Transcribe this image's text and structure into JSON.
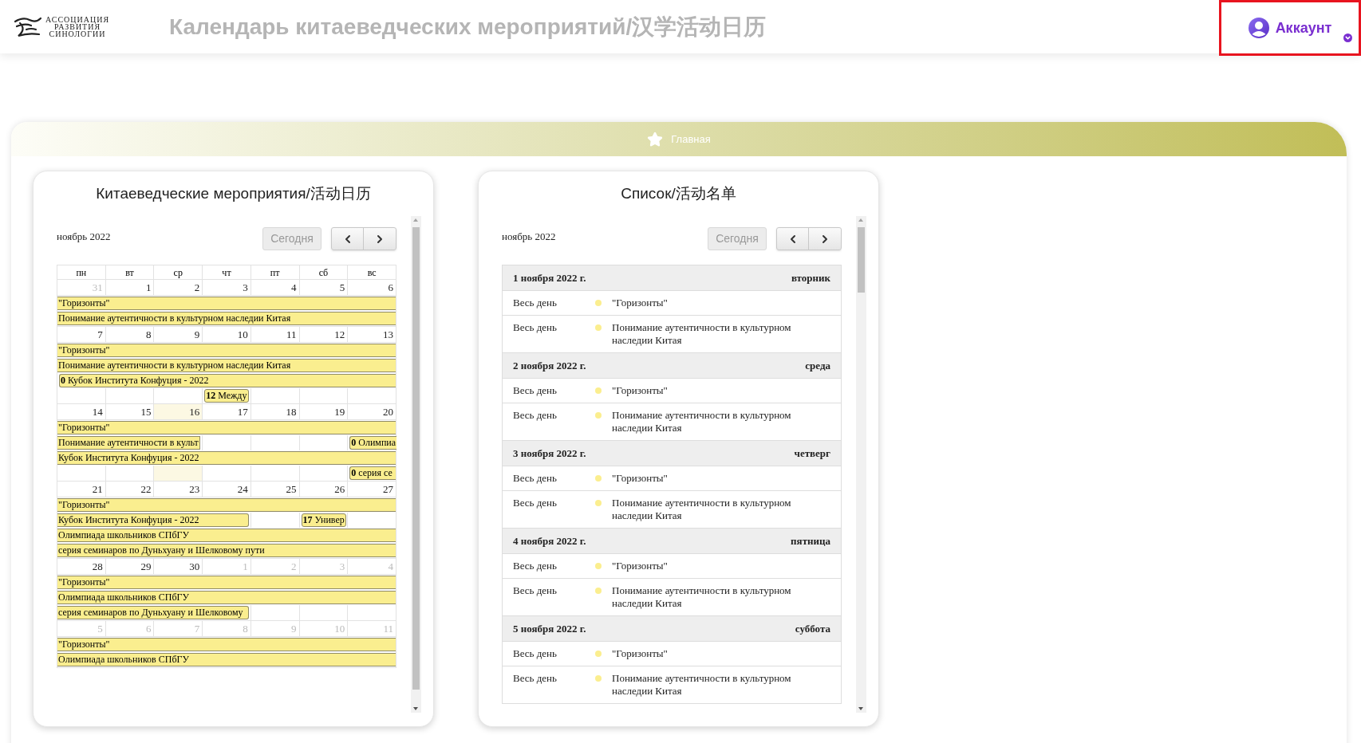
{
  "header": {
    "logo_lines": [
      "АССОЦИАЦИЯ",
      "РАЗВИТИЯ",
      "СИНОЛОГИИ"
    ],
    "title": "Календарь китаеведческих мероприятий/汉学活动日历",
    "account": {
      "label": "Аккаунт",
      "highlighted": true
    }
  },
  "breadcrumb": {
    "label": "Главная"
  },
  "calendar": {
    "title": "Китаеведческие мероприятия/活动日历",
    "month": "ноябрь 2022",
    "today_button": {
      "label": "Сегодня",
      "disabled": true
    },
    "weekdays": [
      "пн",
      "вт",
      "ср",
      "чт",
      "пт",
      "сб",
      "вс"
    ],
    "weeks": [
      {
        "days": [
          {
            "label": "31",
            "other_month": true,
            "today": false
          },
          {
            "label": "1",
            "other_month": false,
            "today": false
          },
          {
            "label": "2",
            "other_month": false,
            "today": false
          },
          {
            "label": "3",
            "other_month": false,
            "today": false
          },
          {
            "label": "4",
            "other_month": false,
            "today": false
          },
          {
            "label": "5",
            "other_month": false,
            "today": false
          },
          {
            "label": "6",
            "other_month": false,
            "today": false
          }
        ],
        "rows": [
          [
            {
              "text": "\"Горизонты\"",
              "starts": false,
              "ends": false
            },
            {
              "continues": true
            },
            {
              "continues": true
            },
            {
              "continues": true
            },
            {
              "continues": true
            },
            {
              "continues": true
            },
            {
              "continues": true
            }
          ],
          [
            {
              "text": "Понимание аутентичности в культурном наследии Китая",
              "starts": false,
              "ends": false
            },
            {
              "continues": true
            },
            {
              "continues": true
            },
            {
              "continues": true
            },
            {
              "continues": true
            },
            {
              "continues": true
            },
            {
              "continues": true
            }
          ]
        ]
      },
      {
        "days": [
          {
            "label": "7",
            "other_month": false,
            "today": false
          },
          {
            "label": "8",
            "other_month": false,
            "today": false
          },
          {
            "label": "9",
            "other_month": false,
            "today": false
          },
          {
            "label": "10",
            "other_month": false,
            "today": false
          },
          {
            "label": "11",
            "other_month": false,
            "today": false
          },
          {
            "label": "12",
            "other_month": false,
            "today": false
          },
          {
            "label": "13",
            "other_month": false,
            "today": false
          }
        ],
        "rows": [
          [
            {
              "text": "\"Горизонты\"",
              "starts": false,
              "ends": false
            },
            {
              "continues": true
            },
            {
              "continues": true
            },
            {
              "continues": true
            },
            {
              "continues": true
            },
            {
              "continues": true
            },
            {
              "continues": true
            }
          ],
          [
            {
              "text": "Понимание аутентичности в культурном наследии Китая",
              "starts": false,
              "ends": false
            },
            {
              "continues": true
            },
            {
              "continues": true
            },
            {
              "continues": true
            },
            {
              "continues": true
            },
            {
              "continues": true
            },
            {
              "continues": true
            }
          ],
          [
            {
              "text": "**0** Кубок Института Конфуция - 2022",
              "starts": true,
              "ends": false
            },
            {
              "continues": true
            },
            {
              "continues": true
            },
            {
              "continues": true
            },
            {
              "continues": true
            },
            {
              "continues": true
            },
            {
              "continues": true
            }
          ],
          [
            null,
            null,
            null,
            {
              "text": "**12** Между",
              "starts": true,
              "ends": true
            },
            null,
            null,
            null
          ]
        ]
      },
      {
        "days": [
          {
            "label": "14",
            "other_month": false,
            "today": false
          },
          {
            "label": "15",
            "other_month": false,
            "today": false
          },
          {
            "label": "16",
            "other_month": false,
            "today": true
          },
          {
            "label": "17",
            "other_month": false,
            "today": false
          },
          {
            "label": "18",
            "other_month": false,
            "today": false
          },
          {
            "label": "19",
            "other_month": false,
            "today": false
          },
          {
            "label": "20",
            "other_month": false,
            "today": false
          }
        ],
        "rows": [
          [
            {
              "text": "\"Горизонты\"",
              "starts": false,
              "ends": false
            },
            {
              "continues": true
            },
            {
              "continues": true
            },
            {
              "continues": true
            },
            {
              "continues": true
            },
            {
              "continues": true
            },
            {
              "continues": true
            }
          ],
          [
            {
              "text": "Понимание аутентичности в культ",
              "starts": false,
              "ends": true
            },
            {
              "continues": true
            },
            {
              "continues": true
            },
            null,
            null,
            null,
            {
              "text": "**0** Олимпиа",
              "starts": true,
              "ends": false
            }
          ],
          [
            {
              "text": "Кубок Института Конфуция - 2022",
              "starts": false,
              "ends": false
            },
            {
              "continues": true
            },
            {
              "continues": true
            },
            {
              "continues": true
            },
            {
              "continues": true
            },
            {
              "continues": true
            },
            {
              "continues": true
            }
          ],
          [
            null,
            null,
            null,
            null,
            null,
            null,
            {
              "text": "**0** серия се",
              "starts": true,
              "ends": false
            }
          ]
        ]
      },
      {
        "days": [
          {
            "label": "21",
            "other_month": false,
            "today": false
          },
          {
            "label": "22",
            "other_month": false,
            "today": false
          },
          {
            "label": "23",
            "other_month": false,
            "today": false
          },
          {
            "label": "24",
            "other_month": false,
            "today": false
          },
          {
            "label": "25",
            "other_month": false,
            "today": false
          },
          {
            "label": "26",
            "other_month": false,
            "today": false
          },
          {
            "label": "27",
            "other_month": false,
            "today": false
          }
        ],
        "rows": [
          [
            {
              "text": "\"Горизонты\"",
              "starts": false,
              "ends": false
            },
            {
              "continues": true
            },
            {
              "continues": true
            },
            {
              "continues": true
            },
            {
              "continues": true
            },
            {
              "continues": true
            },
            {
              "continues": true
            }
          ],
          [
            {
              "text": "Кубок Института Конфуция - 2022",
              "starts": false,
              "ends": true
            },
            {
              "continues": true
            },
            {
              "continues": true
            },
            {
              "continues": true
            },
            null,
            {
              "text": "**17** Универ",
              "starts": true,
              "ends": true
            },
            null
          ],
          [
            {
              "text": "Олимпиада школьников СПбГУ",
              "starts": false,
              "ends": false
            },
            {
              "continues": true
            },
            {
              "continues": true
            },
            {
              "continues": true
            },
            {
              "continues": true
            },
            {
              "continues": true
            },
            {
              "continues": true
            }
          ],
          [
            {
              "text": "серия семинаров по Дуньхуану и Шелковому пути",
              "starts": false,
              "ends": false
            },
            {
              "continues": true
            },
            {
              "continues": true
            },
            {
              "continues": true
            },
            {
              "continues": true
            },
            {
              "continues": true
            },
            {
              "continues": true
            }
          ]
        ]
      },
      {
        "days": [
          {
            "label": "28",
            "other_month": false,
            "today": false
          },
          {
            "label": "29",
            "other_month": false,
            "today": false
          },
          {
            "label": "30",
            "other_month": false,
            "today": false
          },
          {
            "label": "1",
            "other_month": true,
            "today": false
          },
          {
            "label": "2",
            "other_month": true,
            "today": false
          },
          {
            "label": "3",
            "other_month": true,
            "today": false
          },
          {
            "label": "4",
            "other_month": true,
            "today": false
          }
        ],
        "rows": [
          [
            {
              "text": "\"Горизонты\"",
              "starts": false,
              "ends": false
            },
            {
              "continues": true
            },
            {
              "continues": true
            },
            {
              "continues": true
            },
            {
              "continues": true
            },
            {
              "continues": true
            },
            {
              "continues": true
            }
          ],
          [
            {
              "text": "Олимпиада школьников СПбГУ",
              "starts": false,
              "ends": false
            },
            {
              "continues": true
            },
            {
              "continues": true
            },
            {
              "continues": true
            },
            {
              "continues": true
            },
            {
              "continues": true
            },
            {
              "continues": true
            }
          ],
          [
            {
              "text": "серия семинаров по Дуньхуану и Шелковому",
              "starts": false,
              "ends": true
            },
            {
              "continues": true
            },
            {
              "continues": true
            },
            {
              "continues": true
            },
            null,
            null,
            null
          ]
        ]
      },
      {
        "days": [
          {
            "label": "5",
            "other_month": true,
            "today": false
          },
          {
            "label": "6",
            "other_month": true,
            "today": false
          },
          {
            "label": "7",
            "other_month": true,
            "today": false
          },
          {
            "label": "8",
            "other_month": true,
            "today": false
          },
          {
            "label": "9",
            "other_month": true,
            "today": false
          },
          {
            "label": "10",
            "other_month": true,
            "today": false
          },
          {
            "label": "11",
            "other_month": true,
            "today": false
          }
        ],
        "rows": [
          [
            {
              "text": "\"Горизонты\"",
              "starts": false,
              "ends": false
            },
            {
              "continues": true
            },
            {
              "continues": true
            },
            {
              "continues": true
            },
            {
              "continues": true
            },
            {
              "continues": true
            },
            {
              "continues": true
            }
          ],
          [
            {
              "text": "Олимпиада школьников СПбГУ",
              "starts": false,
              "ends": false
            },
            {
              "continues": true
            },
            {
              "continues": true
            },
            {
              "continues": true
            },
            {
              "continues": true
            },
            {
              "continues": true
            },
            {
              "continues": true
            }
          ]
        ]
      }
    ]
  },
  "list": {
    "title": "Список/活动名单",
    "month": "ноябрь 2022",
    "today_button": {
      "label": "Сегодня",
      "disabled": true
    },
    "days": [
      {
        "date": "1 ноября 2022 г.",
        "weekday": "вторник",
        "events": [
          {
            "time": "Весь день",
            "title": "\"Горизонты\""
          },
          {
            "time": "Весь день",
            "title": "Понимание аутентичности в культурном наследии Китая"
          }
        ]
      },
      {
        "date": "2 ноября 2022 г.",
        "weekday": "среда",
        "events": [
          {
            "time": "Весь день",
            "title": "\"Горизонты\""
          },
          {
            "time": "Весь день",
            "title": "Понимание аутентичности в культурном наследии Китая"
          }
        ]
      },
      {
        "date": "3 ноября 2022 г.",
        "weekday": "четверг",
        "events": [
          {
            "time": "Весь день",
            "title": "\"Горизонты\""
          },
          {
            "time": "Весь день",
            "title": "Понимание аутентичности в культурном наследии Китая"
          }
        ]
      },
      {
        "date": "4 ноября 2022 г.",
        "weekday": "пятница",
        "events": [
          {
            "time": "Весь день",
            "title": "\"Горизонты\""
          },
          {
            "time": "Весь день",
            "title": "Понимание аутентичности в культурном наследии Китая"
          }
        ]
      },
      {
        "date": "5 ноября 2022 г.",
        "weekday": "суббота",
        "events": [
          {
            "time": "Весь день",
            "title": "\"Горизонты\""
          },
          {
            "time": "Весь день",
            "title": "Понимание аутентичности в культурном наследии Китая"
          }
        ]
      }
    ]
  }
}
